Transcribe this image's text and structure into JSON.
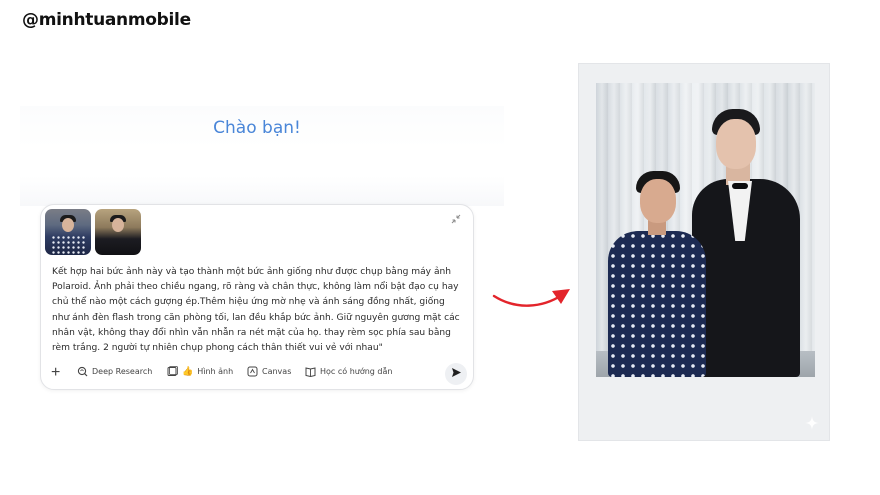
{
  "header": {
    "handle": "@minhtuanmobile"
  },
  "chat": {
    "greeting": "Chào bạn!",
    "prompt": "Kết hợp hai bức ảnh này và tạo thành một bức ảnh giống như được chụp bằng máy ảnh Polaroid. Ảnh phải theo chiều ngang, rõ ràng và chân thực, không làm nổi bật đạo cụ hay chủ thể nào một cách gượng ép.Thêm hiệu ứng mờ nhẹ và ánh sáng đồng nhất, giống như ánh đèn flash trong căn phòng tối, lan đều khắp bức ảnh. Giữ nguyên gương mặt các nhân vật, không thay đổi nhìn vẫn nhẫn ra nét mặt của họ. thay rèm sọc phía sau bằng rèm trắng. 2 người tự nhiên chụp phong cách thân thiết vui vẻ với nhau\"",
    "attachments": [
      {
        "name": "attachment-boy-photo"
      },
      {
        "name": "attachment-man-photo"
      }
    ],
    "toolbar": {
      "deep_research": "Deep Research",
      "image": "Hình ảnh",
      "canvas": "Canvas",
      "guided_learning": "Học có hướng dẫn"
    }
  },
  "icons": {
    "add": "plus-icon",
    "deep_research": "deep-research-icon",
    "image": "image-icon",
    "canvas": "canvas-icon",
    "guided_learning": "book-icon",
    "send": "send-icon",
    "collapse": "collapse-icon",
    "arrow": "curved-arrow-icon",
    "sparkle": "sparkle-icon"
  },
  "colors": {
    "greeting": "#4a86d8",
    "arrow": "#e3242b",
    "polaroid_frame": "#eef0f2"
  }
}
